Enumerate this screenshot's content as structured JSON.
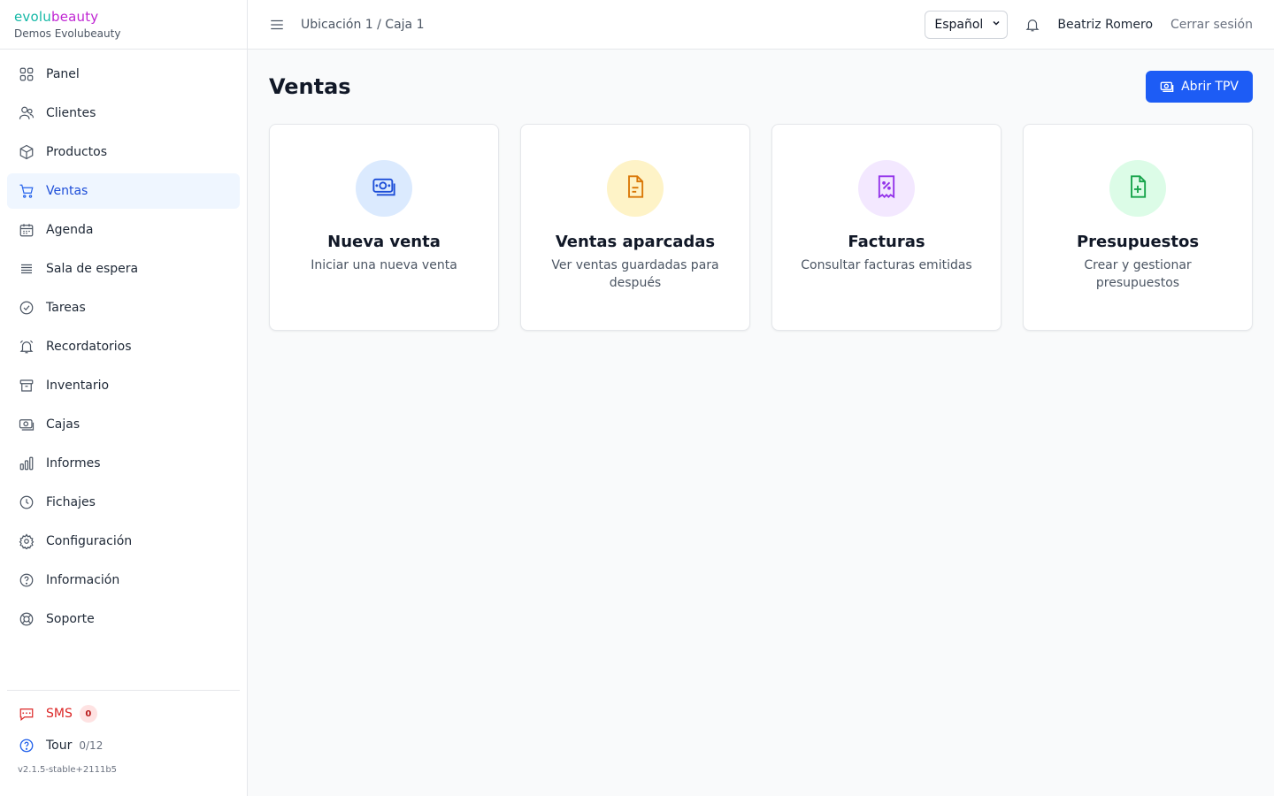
{
  "brand": {
    "logo_part1": "evolu",
    "logo_part2": "beauty",
    "org": "Demos Evolubeauty"
  },
  "sidebar": {
    "items": [
      {
        "label": "Panel",
        "icon": "grid-icon"
      },
      {
        "label": "Clientes",
        "icon": "users-icon"
      },
      {
        "label": "Productos",
        "icon": "box-icon"
      },
      {
        "label": "Ventas",
        "icon": "cart-icon",
        "active": true
      },
      {
        "label": "Agenda",
        "icon": "calendar-icon"
      },
      {
        "label": "Sala de espera",
        "icon": "list-icon"
      },
      {
        "label": "Tareas",
        "icon": "check-circle-icon"
      },
      {
        "label": "Recordatorios",
        "icon": "alarm-icon"
      },
      {
        "label": "Inventario",
        "icon": "archive-icon"
      },
      {
        "label": "Cajas",
        "icon": "cash-icon"
      },
      {
        "label": "Informes",
        "icon": "bar-chart-icon"
      },
      {
        "label": "Fichajes",
        "icon": "clock-icon"
      },
      {
        "label": "Configuración",
        "icon": "gear-icon"
      },
      {
        "label": "Información",
        "icon": "help-circle-icon"
      },
      {
        "label": "Soporte",
        "icon": "lifebuoy-icon"
      }
    ],
    "sms": {
      "label": "SMS",
      "count": "0"
    },
    "tour": {
      "label": "Tour",
      "progress": "0/12"
    },
    "version": "v2.1.5-stable+2111b5"
  },
  "header": {
    "breadcrumb": "Ubicación 1 / Caja 1",
    "language": "Español",
    "user": "Beatriz Romero",
    "logout": "Cerrar sesión"
  },
  "main": {
    "title": "Ventas",
    "primary_button": "Abrir TPV",
    "cards": [
      {
        "title": "Nueva venta",
        "desc": "Iniciar una nueva venta",
        "icon": "cash-icon",
        "bg": "#dbeafe",
        "fg": "#1d4ed8"
      },
      {
        "title": "Ventas aparcadas",
        "desc": "Ver ventas guardadas para después",
        "icon": "document-icon",
        "bg": "#fef3c7",
        "fg": "#d97706"
      },
      {
        "title": "Facturas",
        "desc": "Consultar facturas emitidas",
        "icon": "receipt-percent-icon",
        "bg": "#f3e8ff",
        "fg": "#9333ea"
      },
      {
        "title": "Presupuestos",
        "desc": "Crear y gestionar presupuestos",
        "icon": "document-plus-icon",
        "bg": "#dcfce7",
        "fg": "#16a34a"
      }
    ]
  },
  "colors": {
    "accent": "#1d5cf5",
    "active_bg": "#eff6ff",
    "sms": "#dc2626",
    "logo_teal": "#14b8a6",
    "logo_magenta": "#c026d3"
  }
}
